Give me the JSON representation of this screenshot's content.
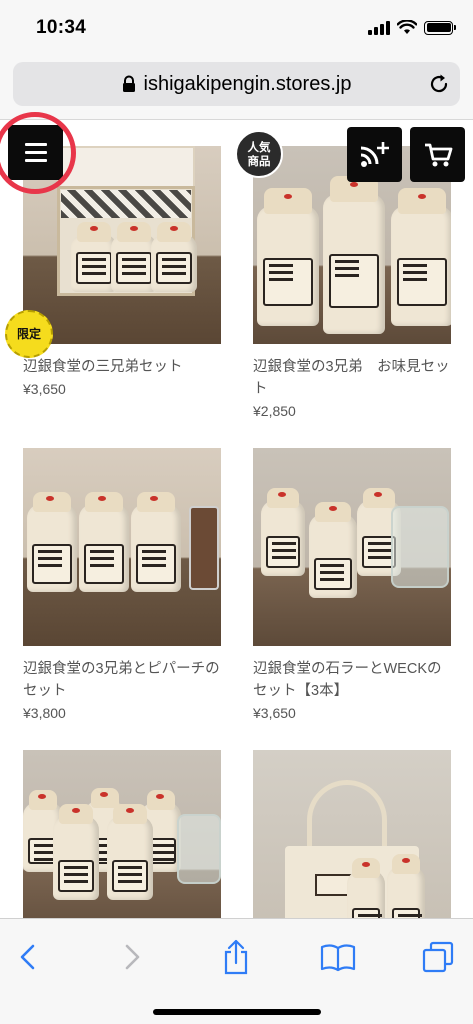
{
  "status_bar": {
    "time": "10:34",
    "icons": [
      "signal-icon",
      "wifi-icon",
      "battery-icon"
    ]
  },
  "browser": {
    "url": "ishigakipengin.stores.jp",
    "lock_icon": "lock-icon",
    "reload_icon": "reload-icon"
  },
  "header_buttons": {
    "menu_icon": "hamburger-menu-icon",
    "feed_icon": "rss-follow-icon",
    "cart_icon": "cart-icon",
    "highlight_color": "#e8364a"
  },
  "badges": {
    "popular": "人気商品",
    "popular_line1": "人気",
    "popular_line2": "商品",
    "limited": "限定"
  },
  "products": [
    {
      "name": "辺銀食堂の三兄弟セット",
      "price": "¥3,650"
    },
    {
      "name": "辺銀食堂の3兄弟　お味見セット",
      "price": "¥2,850"
    },
    {
      "name": "辺銀食堂の3兄弟とピパーチのセット",
      "price": "¥3,800"
    },
    {
      "name": "辺銀食堂の石ラーとWECKのセット【3本】",
      "price": "¥3,650"
    },
    {
      "name": "",
      "price": ""
    },
    {
      "name": "",
      "price": ""
    }
  ],
  "toolbar": {
    "items": [
      "back-icon",
      "forward-icon",
      "share-icon",
      "bookmarks-icon",
      "tabs-icon"
    ],
    "accent": "#2f7cf6"
  }
}
